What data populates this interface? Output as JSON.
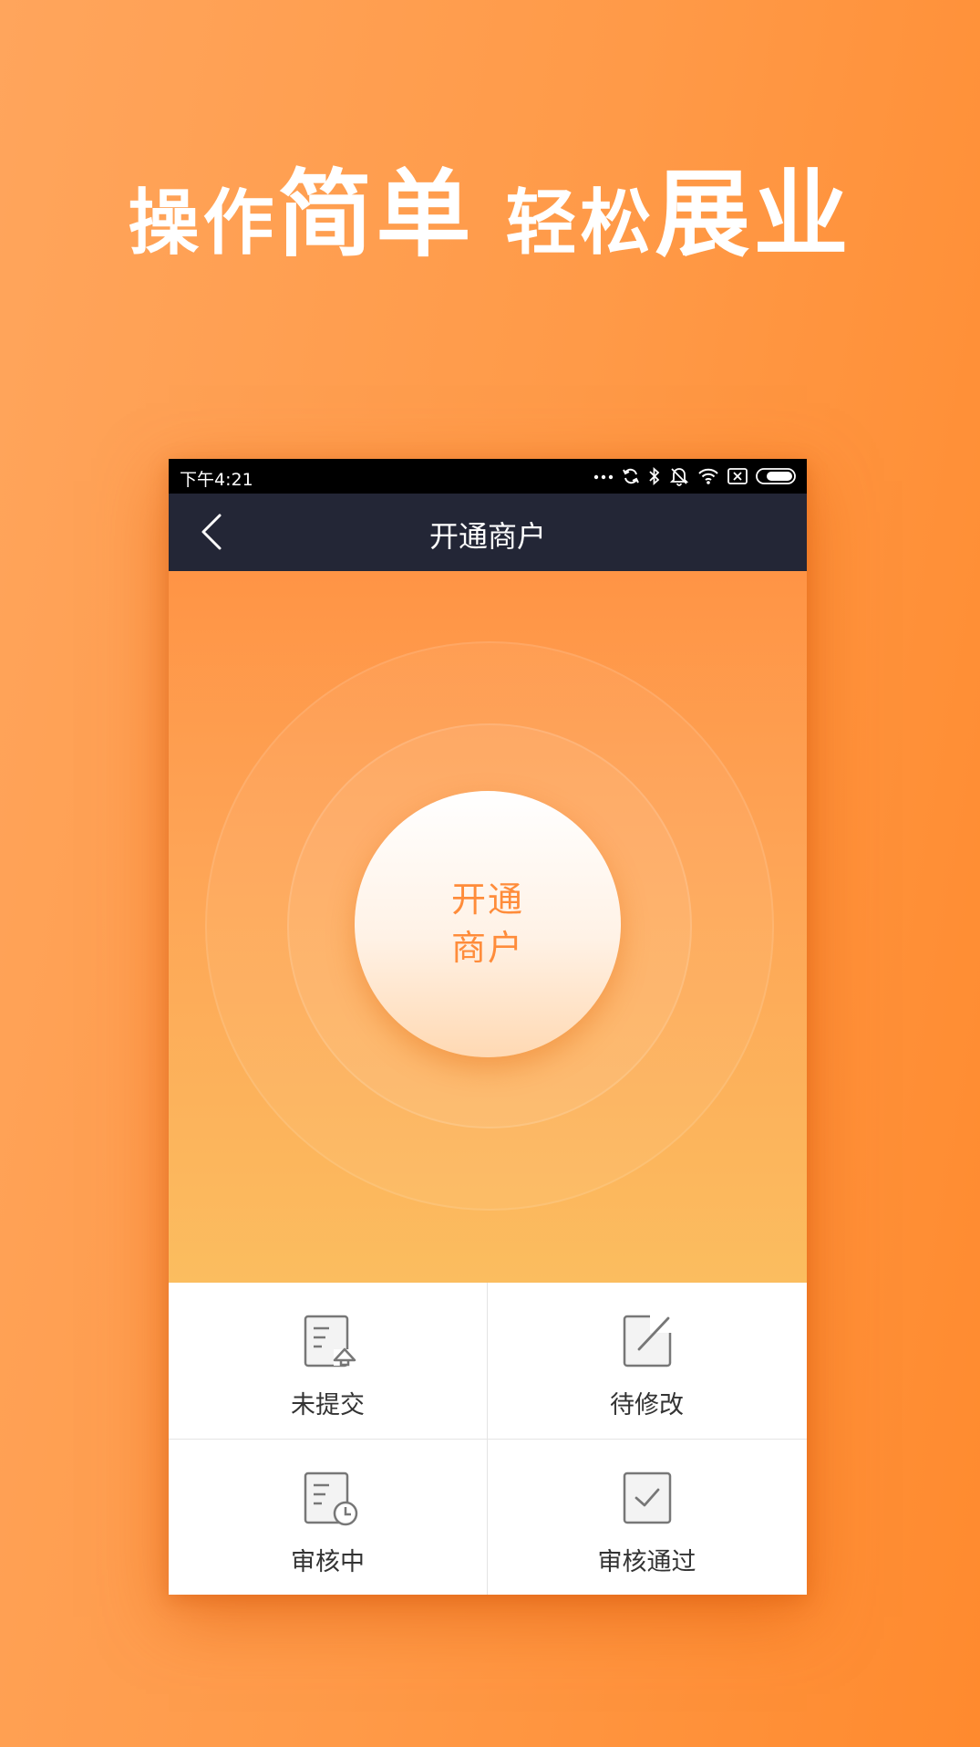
{
  "headline": {
    "part1": "操作",
    "part2": "简单",
    "part3": "轻松",
    "part4": "展业"
  },
  "statusbar": {
    "time": "下午4:21",
    "dots": "..."
  },
  "navbar": {
    "title": "开通商户"
  },
  "hero": {
    "button_line1": "开通",
    "button_line2": "商户"
  },
  "grid": {
    "items": [
      {
        "label": "未提交",
        "icon": "document-upload-icon"
      },
      {
        "label": "待修改",
        "icon": "edit-square-icon"
      },
      {
        "label": "审核中",
        "icon": "document-clock-icon"
      },
      {
        "label": "审核通过",
        "icon": "checkbox-check-icon"
      }
    ]
  },
  "colors": {
    "background": "#ff9a48",
    "navbar": "#232636",
    "accent": "#ff8c3a"
  }
}
